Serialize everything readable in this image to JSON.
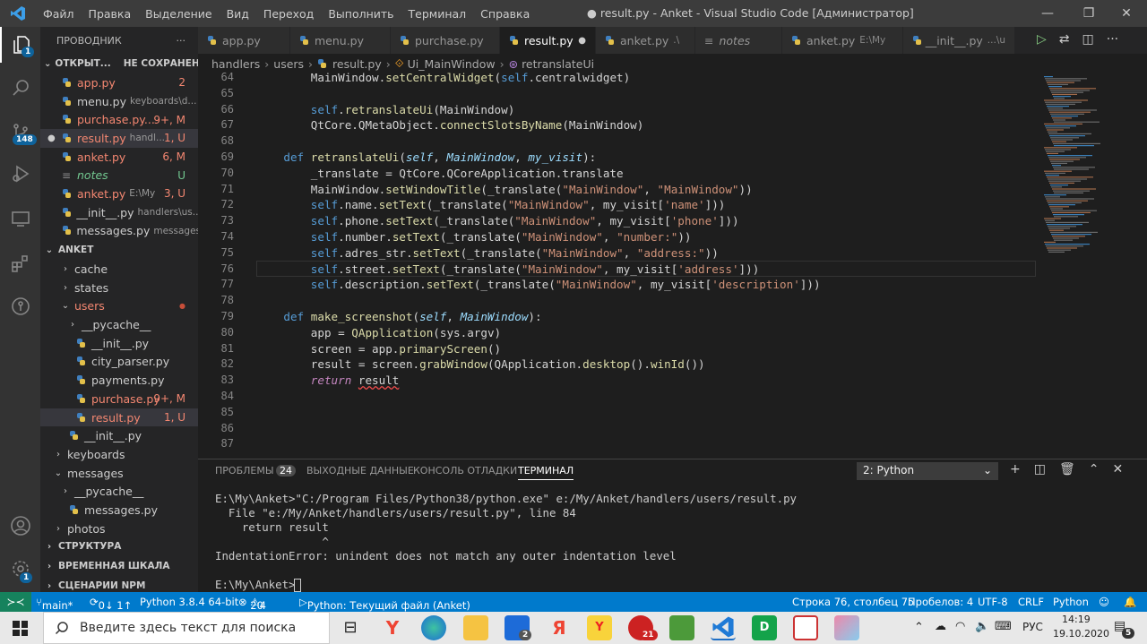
{
  "titlebar": {
    "menu": [
      "Файл",
      "Правка",
      "Выделение",
      "Вид",
      "Переход",
      "Выполнить",
      "Терминал",
      "Справка"
    ],
    "title": "● result.py - Anket - Visual Studio Code [Администратор]"
  },
  "activity": {
    "scm_badge": "148",
    "account_badge": "1",
    "explorer_badge": "1"
  },
  "sidebar": {
    "header": "ПРОВОДНИК",
    "header_more": "···",
    "open_editors": {
      "label": "ОТКРЫТ...",
      "unsaved": "НЕ СОХРАНЕНО: 1",
      "items": [
        {
          "name": "app.py",
          "suffix": "",
          "status": "2",
          "cls": "err"
        },
        {
          "name": "menu.py",
          "suffix": "keyboards\\d...",
          "status": "",
          "cls": ""
        },
        {
          "name": "purchase.py...",
          "suffix": "",
          "status": "9+, M",
          "cls": "err"
        },
        {
          "name": "result.py",
          "suffix": "handl...",
          "status": "1, U",
          "cls": "err"
        },
        {
          "name": "anket.py",
          "suffix": "",
          "status": "6, M",
          "cls": "err"
        },
        {
          "name": "notes",
          "suffix": "",
          "status": "U",
          "cls": "untr"
        },
        {
          "name": "anket.py",
          "suffix": "E:\\My",
          "status": "3, U",
          "cls": "err"
        },
        {
          "name": "__init__.py",
          "suffix": "handlers\\us...",
          "status": "",
          "cls": ""
        },
        {
          "name": "messages.py",
          "suffix": "messages",
          "status": "",
          "cls": ""
        }
      ]
    },
    "project": "ANKET",
    "tree": [
      {
        "name": "cache",
        "indent": 1,
        "type": "folder",
        "open": false,
        "cls": "",
        "status": ""
      },
      {
        "name": "states",
        "indent": 1,
        "type": "folder",
        "open": false,
        "cls": "",
        "status": ""
      },
      {
        "name": "users",
        "indent": 1,
        "type": "folder",
        "open": true,
        "cls": "err",
        "status": "●"
      },
      {
        "name": "__pycache__",
        "indent": 2,
        "type": "folder",
        "open": false,
        "cls": "",
        "status": ""
      },
      {
        "name": "__init__.py",
        "indent": 2,
        "type": "file",
        "cls": "",
        "status": ""
      },
      {
        "name": "city_parser.py",
        "indent": 2,
        "type": "file",
        "cls": "",
        "status": ""
      },
      {
        "name": "payments.py",
        "indent": 2,
        "type": "file",
        "cls": "",
        "status": ""
      },
      {
        "name": "purchase.py",
        "indent": 2,
        "type": "file",
        "cls": "err",
        "status": "9+, M"
      },
      {
        "name": "result.py",
        "indent": 2,
        "type": "file",
        "cls": "err",
        "status": "1, U"
      },
      {
        "name": "__init__.py",
        "indent": 1,
        "type": "file",
        "cls": "",
        "status": ""
      },
      {
        "name": "keyboards",
        "indent": 0,
        "type": "folder",
        "open": false,
        "cls": "",
        "status": ""
      },
      {
        "name": "messages",
        "indent": 0,
        "type": "folder",
        "open": true,
        "cls": "",
        "status": ""
      },
      {
        "name": "__pycache__",
        "indent": 1,
        "type": "folder",
        "open": false,
        "cls": "",
        "status": ""
      },
      {
        "name": "messages.py",
        "indent": 1,
        "type": "file",
        "cls": "",
        "status": ""
      },
      {
        "name": "photos",
        "indent": 0,
        "type": "folder",
        "open": false,
        "cls": "",
        "status": ""
      }
    ],
    "bottom_sections": [
      "СТРУКТУРА",
      "ВРЕМЕННАЯ ШКАЛА",
      "СЦЕНАРИИ NPM"
    ]
  },
  "tabs": [
    {
      "name": "app.py",
      "suffix": "",
      "active": false
    },
    {
      "name": "menu.py",
      "suffix": "",
      "active": false
    },
    {
      "name": "purchase.py",
      "suffix": "",
      "active": false
    },
    {
      "name": "result.py",
      "suffix": "",
      "active": true
    },
    {
      "name": "anket.py",
      "suffix": ".\\",
      "active": false
    },
    {
      "name": "notes",
      "suffix": "",
      "active": false
    },
    {
      "name": "anket.py",
      "suffix": "E:\\My",
      "active": false
    },
    {
      "name": "__init__.py",
      "suffix": "...\\u",
      "active": false
    }
  ],
  "breadcrumb": [
    "handlers",
    "users",
    "result.py",
    "Ui_MainWindow",
    "retranslateUi"
  ],
  "code": [
    {
      "n": "64",
      "t": [
        [
          "MainWindow.",
          "d"
        ],
        [
          "setCentralWidget",
          "fn"
        ],
        [
          "(",
          "d"
        ],
        [
          "self",
          "selfk"
        ],
        [
          ".centralwidget)",
          "d"
        ]
      ],
      "i": 8
    },
    {
      "n": "65",
      "t": [],
      "i": 0
    },
    {
      "n": "66",
      "t": [
        [
          "self",
          "selfk"
        ],
        [
          ".",
          "d"
        ],
        [
          "retranslateUi",
          "fn"
        ],
        [
          "(MainWindow)",
          "d"
        ]
      ],
      "i": 8
    },
    {
      "n": "67",
      "t": [
        [
          "QtCore.QMetaObject.",
          "d"
        ],
        [
          "connectSlotsByName",
          "fn"
        ],
        [
          "(MainWindow)",
          "d"
        ]
      ],
      "i": 8
    },
    {
      "n": "68",
      "t": [],
      "i": 0
    },
    {
      "n": "69",
      "t": [
        [
          "def ",
          "kw"
        ],
        [
          "retranslateUi",
          "fn"
        ],
        [
          "(",
          "d"
        ],
        [
          "self",
          "pr"
        ],
        [
          ", ",
          "d"
        ],
        [
          "MainWindow",
          "pr"
        ],
        [
          ", ",
          "d"
        ],
        [
          "my_visit",
          "pr"
        ],
        [
          "):",
          "d"
        ]
      ],
      "i": 4
    },
    {
      "n": "70",
      "t": [
        [
          "_translate = QtCore.QCoreApplication.translate",
          "d"
        ]
      ],
      "i": 8
    },
    {
      "n": "71",
      "t": [
        [
          "MainWindow.",
          "d"
        ],
        [
          "setWindowTitle",
          "fn"
        ],
        [
          "(_translate(",
          "d"
        ],
        [
          "\"MainWindow\"",
          "str"
        ],
        [
          ", ",
          "d"
        ],
        [
          "\"MainWindow\"",
          "str"
        ],
        [
          "))",
          "d"
        ]
      ],
      "i": 8
    },
    {
      "n": "72",
      "t": [
        [
          "self",
          "selfk"
        ],
        [
          ".name.",
          "d"
        ],
        [
          "setText",
          "fn"
        ],
        [
          "(_translate(",
          "d"
        ],
        [
          "\"MainWindow\"",
          "str"
        ],
        [
          ", my_visit[",
          "d"
        ],
        [
          "'name'",
          "str"
        ],
        [
          "]))",
          "d"
        ]
      ],
      "i": 8
    },
    {
      "n": "73",
      "t": [
        [
          "self",
          "selfk"
        ],
        [
          ".phone.",
          "d"
        ],
        [
          "setText",
          "fn"
        ],
        [
          "(_translate(",
          "d"
        ],
        [
          "\"MainWindow\"",
          "str"
        ],
        [
          ", my_visit[",
          "d"
        ],
        [
          "'phone'",
          "str"
        ],
        [
          "]))",
          "d"
        ]
      ],
      "i": 8
    },
    {
      "n": "74",
      "t": [
        [
          "self",
          "selfk"
        ],
        [
          ".number.",
          "d"
        ],
        [
          "setText",
          "fn"
        ],
        [
          "(_translate(",
          "d"
        ],
        [
          "\"MainWindow\"",
          "str"
        ],
        [
          ", ",
          "d"
        ],
        [
          "\"number:\"",
          "str"
        ],
        [
          "))",
          "d"
        ]
      ],
      "i": 8
    },
    {
      "n": "75",
      "t": [
        [
          "self",
          "selfk"
        ],
        [
          ".adres_str.",
          "d"
        ],
        [
          "setText",
          "fn"
        ],
        [
          "(_translate(",
          "d"
        ],
        [
          "\"MainWindow\"",
          "str"
        ],
        [
          ", ",
          "d"
        ],
        [
          "\"address:\"",
          "str"
        ],
        [
          "))",
          "d"
        ]
      ],
      "i": 8
    },
    {
      "n": "76",
      "t": [
        [
          "self",
          "selfk"
        ],
        [
          ".street.",
          "d"
        ],
        [
          "setText",
          "fn"
        ],
        [
          "(_translate(",
          "d"
        ],
        [
          "\"MainWindow\"",
          "str"
        ],
        [
          ", my_visit[",
          "d"
        ],
        [
          "'address'",
          "str"
        ],
        [
          "]))",
          "d"
        ]
      ],
      "i": 8
    },
    {
      "n": "77",
      "t": [
        [
          "self",
          "selfk"
        ],
        [
          ".description.",
          "d"
        ],
        [
          "setText",
          "fn"
        ],
        [
          "(_translate(",
          "d"
        ],
        [
          "\"MainWindow\"",
          "str"
        ],
        [
          ", my_visit[",
          "d"
        ],
        [
          "'description'",
          "str"
        ],
        [
          "]))",
          "d"
        ]
      ],
      "i": 8
    },
    {
      "n": "78",
      "t": [],
      "i": 0
    },
    {
      "n": "79",
      "t": [
        [
          "def ",
          "kw"
        ],
        [
          "make_screenshot",
          "fn"
        ],
        [
          "(",
          "d"
        ],
        [
          "self",
          "pr"
        ],
        [
          ", ",
          "d"
        ],
        [
          "MainWindow",
          "pr"
        ],
        [
          "):",
          "d"
        ]
      ],
      "i": 4
    },
    {
      "n": "80",
      "t": [
        [
          "app = ",
          "d"
        ],
        [
          "QApplication",
          "fn"
        ],
        [
          "(sys.argv)",
          "d"
        ]
      ],
      "i": 8
    },
    {
      "n": "81",
      "t": [
        [
          "screen = app.",
          "d"
        ],
        [
          "primaryScreen",
          "fn"
        ],
        [
          "()",
          "d"
        ]
      ],
      "i": 8
    },
    {
      "n": "82",
      "t": [
        [
          "result = screen.",
          "d"
        ],
        [
          "grabWindow",
          "fn"
        ],
        [
          "(QApplication.",
          "d"
        ],
        [
          "desktop",
          "fn"
        ],
        [
          "().",
          "d"
        ],
        [
          "winId",
          "fn"
        ],
        [
          "())",
          "d"
        ]
      ],
      "i": 8
    },
    {
      "n": "83",
      "t": [
        [
          "return ",
          "kwi"
        ],
        [
          "result",
          "d"
        ]
      ],
      "i": 8
    },
    {
      "n": "84",
      "t": [],
      "i": 0
    },
    {
      "n": "85",
      "t": [],
      "i": 0
    },
    {
      "n": "86",
      "t": [],
      "i": 0
    },
    {
      "n": "87",
      "t": [],
      "i": 0
    }
  ],
  "panel": {
    "tabs": [
      "ПРОБЛЕМЫ",
      "ВЫХОДНЫЕ ДАННЫЕ",
      "КОНСОЛЬ ОТЛАДКИ",
      "ТЕРМИНАЛ"
    ],
    "problems_count": "24",
    "terminal_select": "2: Python",
    "terminal_lines": [
      "E:\\My\\Anket>\"C:/Program Files/Python38/python.exe\" e:/My/Anket/handlers/users/result.py",
      "  File \"e:/My/Anket/handlers/users/result.py\", line 84",
      "    return result",
      "                ^",
      "IndentationError: unindent does not match any outer indentation level",
      "",
      "E:\\My\\Anket>"
    ]
  },
  "statusbar": {
    "branch": "main*",
    "sync": "0↓ 1↑",
    "python": "Python 3.8.4 64-bit",
    "errors": "20",
    "warnings": "4",
    "run": "Python: Текущий файл (Anket)",
    "position": "Строка 76, столбец 75",
    "spaces": "Пробелов: 4",
    "encoding": "UTF-8",
    "eol": "CRLF",
    "language": "Python"
  },
  "taskbar": {
    "search_placeholder": "Введите здесь текст для поиска",
    "lang": "РУС",
    "time": "14:19",
    "date": "19.10.2020",
    "notif": "5",
    "badge_mail": "2",
    "badge_opera": "21"
  }
}
